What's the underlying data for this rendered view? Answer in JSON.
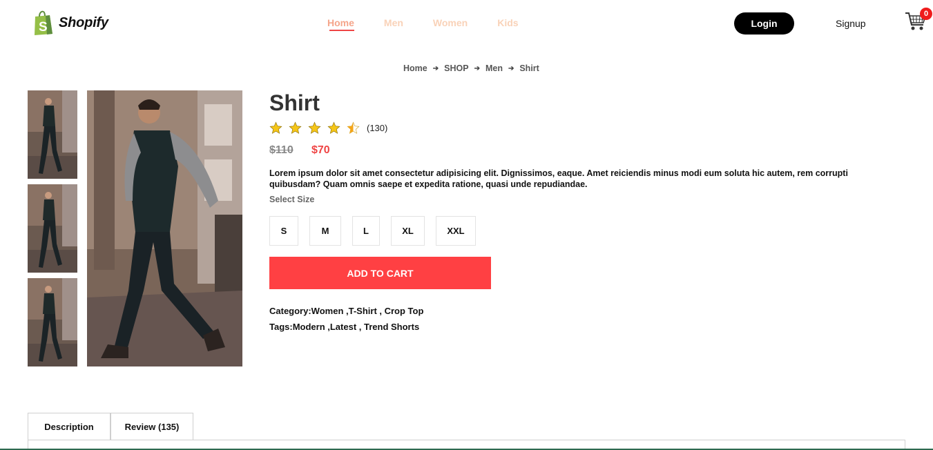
{
  "brand": {
    "name": "Shopify"
  },
  "nav": {
    "items": [
      {
        "label": "Home",
        "active": true
      },
      {
        "label": "Men",
        "active": false
      },
      {
        "label": "Women",
        "active": false
      },
      {
        "label": "Kids",
        "active": false
      }
    ],
    "login_label": "Login",
    "signup_label": "Signup",
    "cart_count": "0"
  },
  "breadcrumb": [
    "Home",
    "SHOP",
    "Men",
    "Shirt"
  ],
  "product": {
    "title": "Shirt",
    "rating": 4.5,
    "rating_count": "(130)",
    "old_price": "$110",
    "new_price": "$70",
    "description": "Lorem ipsum dolor sit amet consectetur adipisicing elit. Dignissimos, eaque. Amet reiciendis minus modi eum soluta hic autem, rem corrupti quibusdam? Quam omnis saepe et expedita ratione, quasi unde repudiandae.",
    "select_size_label": "Select Size",
    "sizes": [
      "S",
      "M",
      "L",
      "XL",
      "XXL"
    ],
    "add_to_cart_label": "ADD TO CART",
    "category_line": "Category:Women ,T-Shirt , Crop Top",
    "tags_line": "Tags:Modern ,Latest , Trend Shorts"
  },
  "tabs": [
    {
      "label": "Description"
    },
    {
      "label": "Review (135)"
    }
  ],
  "colors": {
    "accent": "#ff4043",
    "nav_active": "#f5a58a",
    "nav_inactive": "#f9d2b8",
    "star": "#f5c518"
  }
}
